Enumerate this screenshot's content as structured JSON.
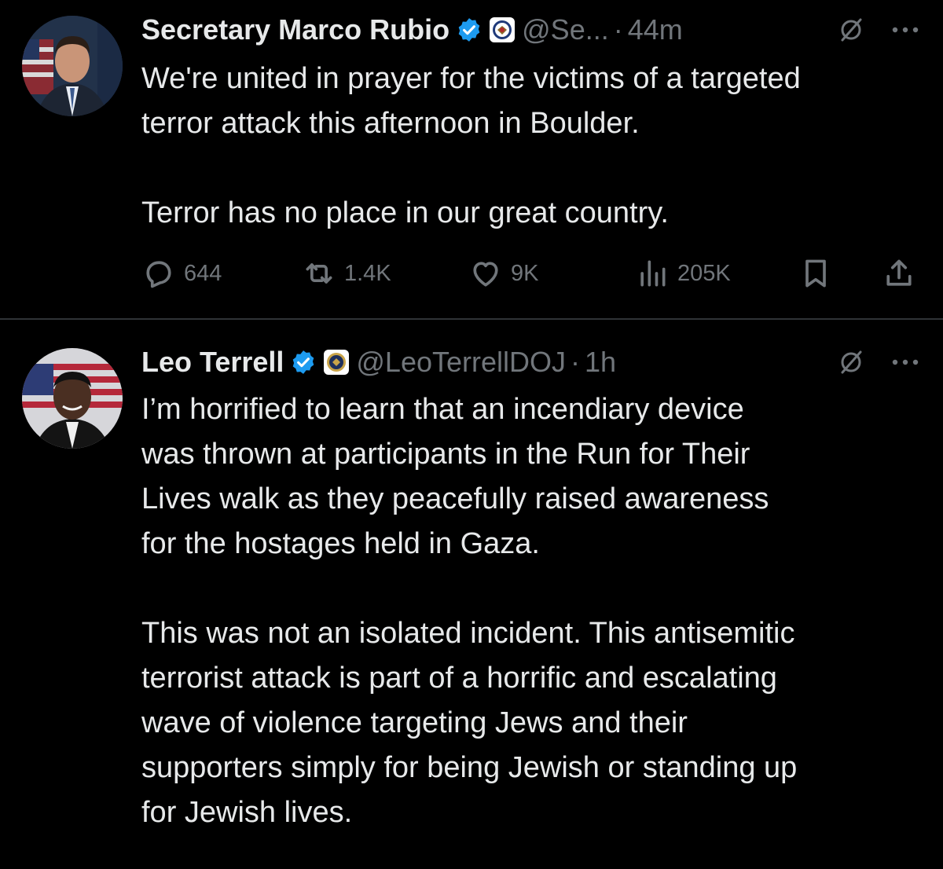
{
  "tweets": [
    {
      "author_name": "Secretary Marco Rubio",
      "handle": "@Se...",
      "dot": "·",
      "time": "44m",
      "text": "We're united in prayer for the victims of a targeted\nterror attack this afternoon in Boulder.\n\nTerror has no place in our great country.",
      "stats": {
        "replies": "644",
        "reposts": "1.4K",
        "likes": "9K",
        "views": "205K"
      }
    },
    {
      "author_name": "Leo Terrell",
      "handle": "@LeoTerrellDOJ",
      "dot": "·",
      "time": "1h",
      "text": "I’m horrified to learn that an incendiary device\nwas thrown at participants in the Run for Their\nLives walk as they peacefully raised awareness\nfor the hostages held in Gaza.\n\nThis was not an isolated incident. This antisemitic\nterrorist attack is part of a horrific and escalating\nwave of violence targeting Jews and their\nsupporters simply for being Jewish or standing up\nfor Jewish lives."
    }
  ],
  "colors": {
    "background": "#000000",
    "text": "#e7e9ea",
    "muted": "#71767b",
    "verified": "#1d9bf0",
    "divider": "#2f3336"
  },
  "icons": [
    "verified-badge-icon",
    "affiliation-seal-icon",
    "grok-icon",
    "more-icon",
    "reply-icon",
    "repost-icon",
    "like-icon",
    "views-icon",
    "bookmark-icon",
    "share-icon"
  ]
}
